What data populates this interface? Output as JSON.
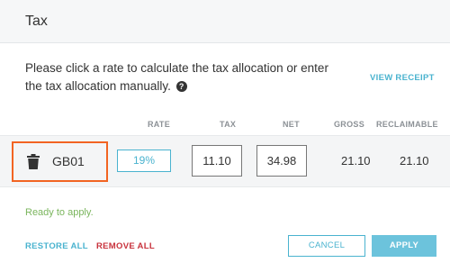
{
  "header": {
    "title": "Tax"
  },
  "instructions": {
    "text": "Please click a rate to calculate the tax allocation or enter the tax allocation manually."
  },
  "view_receipt_label": "VIEW RECEIPT",
  "columns": {
    "rate": "RATE",
    "tax": "TAX",
    "net": "NET",
    "gross": "GROSS",
    "reclaimable": "RECLAIMABLE"
  },
  "row": {
    "code": "GB01",
    "rate": "19%",
    "tax": "11.10",
    "net": "34.98",
    "gross": "21.10",
    "reclaimable": "21.10"
  },
  "status": "Ready to apply.",
  "actions": {
    "restore_all": "RESTORE ALL",
    "remove_all": "REMOVE ALL",
    "cancel": "CANCEL",
    "apply": "APPLY"
  },
  "colors": {
    "accent": "#4ab3cf",
    "highlight": "#f26422",
    "danger": "#c8323c",
    "success": "#7ab55c"
  }
}
